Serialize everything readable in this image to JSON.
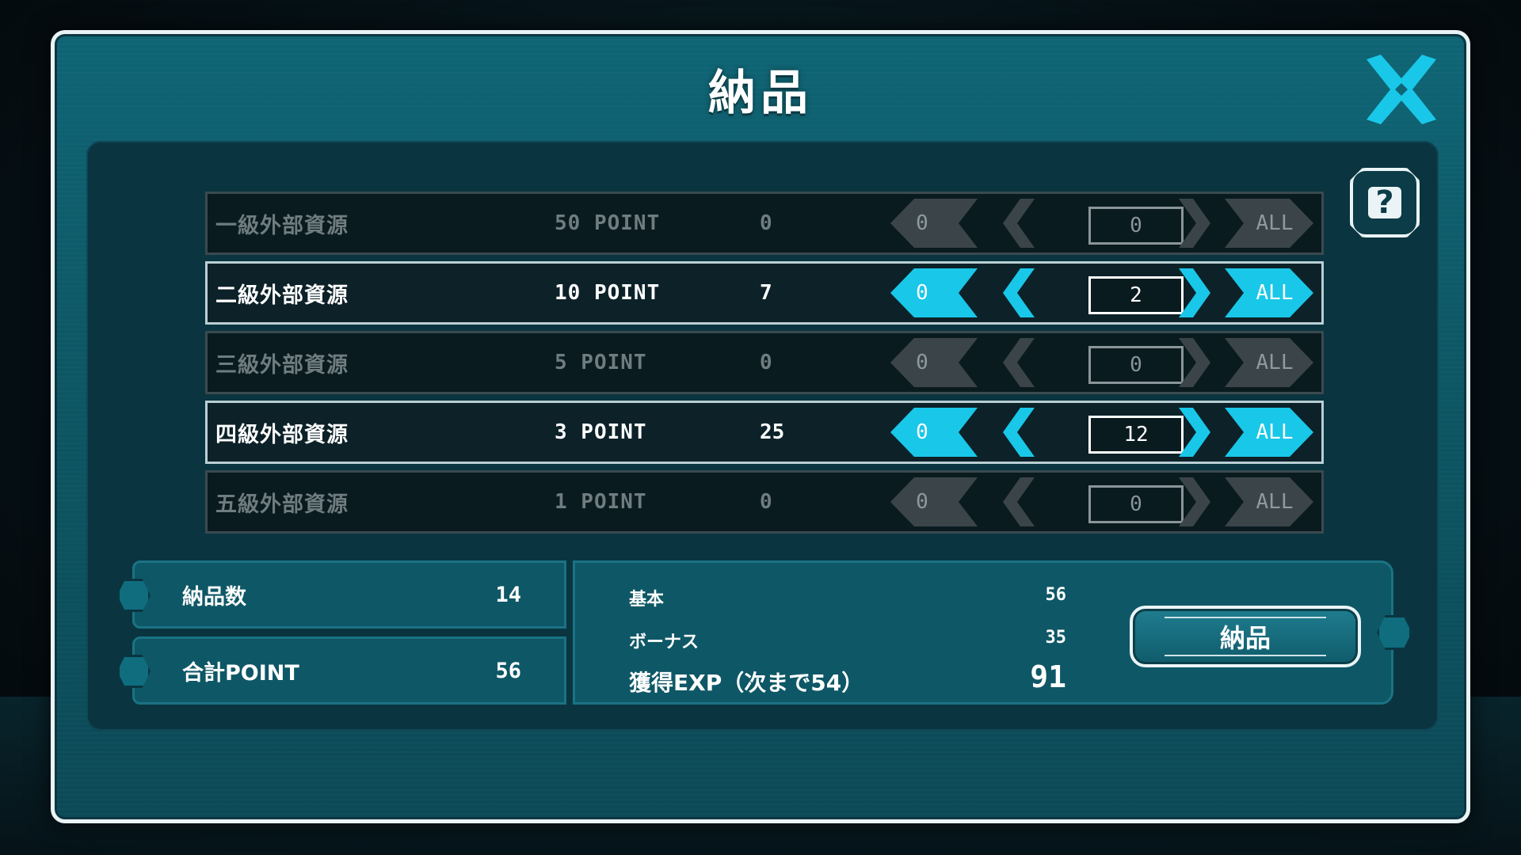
{
  "dialog": {
    "title": "納品",
    "close_icon": "close-x-icon",
    "help_label": "?"
  },
  "colors": {
    "accent": "#19c7e8",
    "panel": "#0a3540",
    "frame": "#0f6575",
    "inactive": "#6f7c80"
  },
  "resources": [
    {
      "name": "一級外部資源",
      "points": "50 POINT",
      "owned": "0",
      "zero_label": "0",
      "quantity": "0",
      "all_label": "ALL",
      "active": false
    },
    {
      "name": "二級外部資源",
      "points": "10 POINT",
      "owned": "7",
      "zero_label": "0",
      "quantity": "2",
      "all_label": "ALL",
      "active": true
    },
    {
      "name": "三級外部資源",
      "points": "5 POINT",
      "owned": "0",
      "zero_label": "0",
      "quantity": "0",
      "all_label": "ALL",
      "active": false
    },
    {
      "name": "四級外部資源",
      "points": "3 POINT",
      "owned": "25",
      "zero_label": "0",
      "quantity": "12",
      "all_label": "ALL",
      "active": true
    },
    {
      "name": "五級外部資源",
      "points": "1 POINT",
      "owned": "0",
      "zero_label": "0",
      "quantity": "0",
      "all_label": "ALL",
      "active": false
    }
  ],
  "summary": {
    "count_label": "納品数",
    "count_value": "14",
    "total_label": "合計POINT",
    "total_value": "56",
    "base_label": "基本",
    "base_value": "56",
    "bonus_label": "ボーナス",
    "bonus_value": "35",
    "exp_label": "獲得EXP（次まで54）",
    "exp_value": "91",
    "submit_label": "納品"
  }
}
